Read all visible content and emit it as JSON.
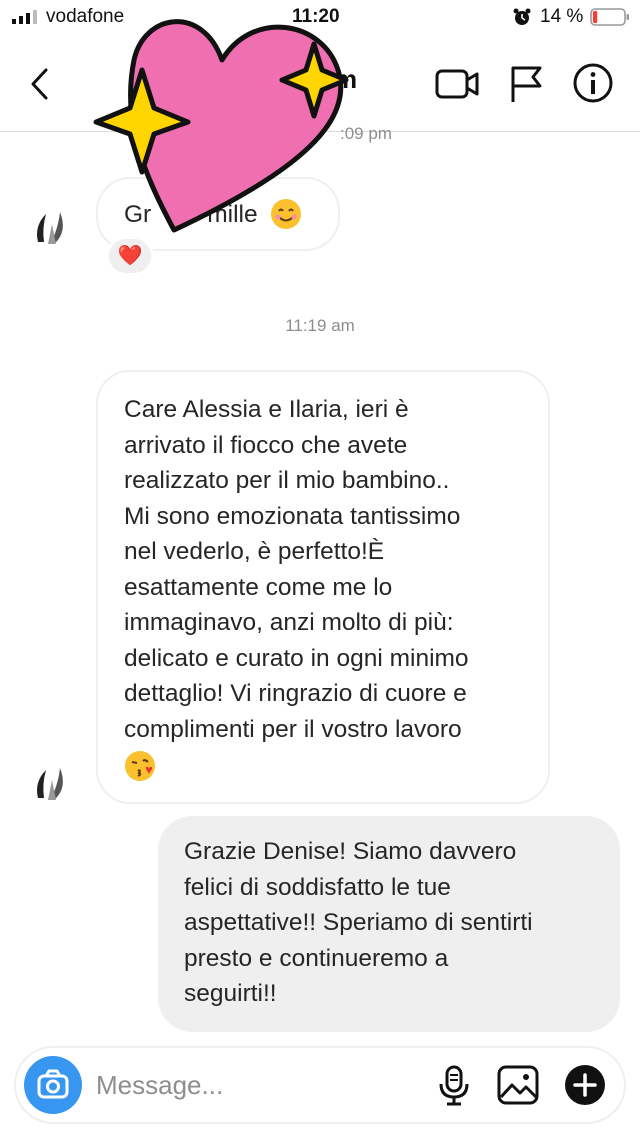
{
  "status_bar": {
    "carrier": "vodafone",
    "time": "11:20",
    "battery_percent": "14 %",
    "battery_level": 0.14
  },
  "header": {
    "title": "m"
  },
  "conversation": {
    "timestamp_top": ":09 pm",
    "first_message_visible": {
      "text_start": "Gr",
      "text_end": "mille"
    },
    "reaction": "❤️",
    "timestamp_middle": "11:19 am",
    "incoming_message_lines": [
      "Care Alessia e Ilaria, ieri è",
      "arrivato il fiocco che avete",
      "realizzato per il mio bambino..",
      "Mi sono emozionata tantissimo",
      "nel vederlo, è perfetto!È",
      "esattamente come me lo",
      "immaginavo, anzi molto di più:",
      "delicato e curato in ogni minimo",
      "dettaglio! Vi ringrazio di cuore e",
      "complimenti per il vostro lavoro"
    ],
    "outgoing_message_lines": [
      "Grazie Denise! Siamo davvero",
      "felici di soddisfatto le tue",
      "aspettative!! Speriamo di sentirti",
      "presto e continueremo a",
      "seguirti!!"
    ]
  },
  "composer": {
    "placeholder": "Message..."
  },
  "icons": {
    "back": "chevron-left-icon",
    "video": "video-camera-icon",
    "flag": "flag-icon",
    "info": "info-icon",
    "camera": "camera-icon",
    "mic": "microphone-icon",
    "gallery": "image-gallery-icon",
    "plus": "plus-icon",
    "smile_emoji": "smiling-face-emoji",
    "kiss_emoji": "face-blowing-kiss-emoji"
  },
  "colors": {
    "accent": "#3797f0",
    "bubble_out": "#efefef",
    "text": "#262626",
    "muted": "#8e8e8e",
    "battery_low": "#ff3b30",
    "sticker_pink": "#ef6fb0",
    "sticker_yellow": "#ffd500"
  }
}
